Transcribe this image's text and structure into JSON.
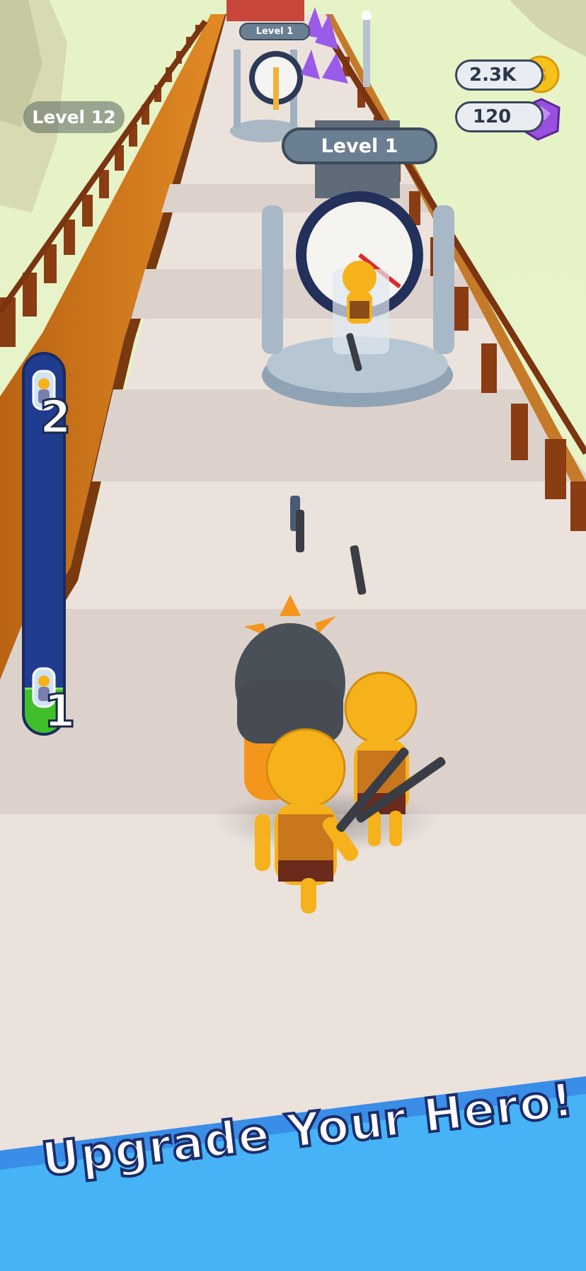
{
  "hud": {
    "level_label": "Level 12",
    "coins": "2.3K",
    "gems": "120"
  },
  "gates": {
    "near_label": "Level 1",
    "far_label": "Level 1"
  },
  "progress": {
    "top_stage": "2",
    "bottom_stage": "1",
    "fill_fraction": 0.12
  },
  "banner": {
    "text": "Upgrade Your Hero!"
  },
  "colors": {
    "track": "#ebe2dc",
    "progress_fill": "#3fbf2a",
    "progress_bg": "#1f3c8f",
    "banner": "#45b3f5",
    "hero": "#f6b21a"
  }
}
